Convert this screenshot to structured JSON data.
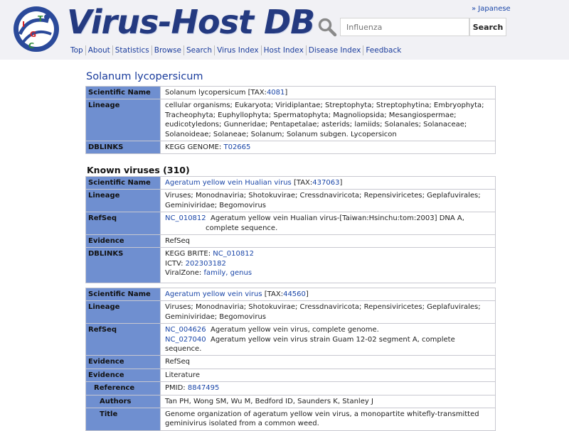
{
  "header": {
    "site_title": "Virus-Host DB",
    "lang_link": "» Japanese",
    "search_placeholder": "Influenza",
    "search_button": "Search"
  },
  "nav": [
    "Top",
    "About",
    "Statistics",
    "Browse",
    "Search",
    "Virus Index",
    "Host Index",
    "Disease Index",
    "Feedback"
  ],
  "host": {
    "title": "Solanum lycopersicum",
    "sci_label": "Scientific Name",
    "sci_value": "Solanum lycopersicum [TAX:",
    "tax_id": "4081",
    "tax_close": "]",
    "lineage_label": "Lineage",
    "lineage": "cellular organisms; Eukaryota; Viridiplantae; Streptophyta; Streptophytina; Embryophyta; Tracheophyta; Euphyllophyta; Spermatophyta; Magnoliopsida; Mesangiospermae; eudicotyledons; Gunneridae; Pentapetalae; asterids; lamiids; Solanales; Solanaceae; Solanoideae; Solaneae; Solanum; Solanum subgen. Lycopersicon",
    "dblinks_label": "DBLINKS",
    "dblinks_prefix": "KEGG GENOME: ",
    "dblinks_id": "T02665"
  },
  "known_viruses_title": "Known viruses (310)",
  "virus1": {
    "sci_label": "Scientific Name",
    "name": "Ageratum yellow vein Hualian virus",
    "tax_open": " [TAX:",
    "tax_id": "437063",
    "tax_close": "]",
    "lineage_label": "Lineage",
    "lineage": "Viruses; Monodnaviria; Shotokuvirae; Cressdnaviricota; Repensiviricetes; Geplafuvirales; Geminiviridae; Begomovirus",
    "refseq_label": "RefSeq",
    "refseq_id": "NC_010812",
    "refseq_desc_1": "Ageratum yellow vein Hualian virus-[Taiwan:Hsinchu:tom:2003] DNA A,",
    "refseq_desc_2": "complete sequence.",
    "evidence_label": "Evidence",
    "evidence": "RefSeq",
    "dblinks_label": "DBLINKS",
    "kegg_label": "KEGG BRITE: ",
    "kegg_id": "NC_010812",
    "ictv_label": "ICTV: ",
    "ictv_id": "202303182",
    "viralzone_label": "ViralZone: ",
    "viralzone_links": "family, genus"
  },
  "virus2": {
    "sci_label": "Scientific Name",
    "name": "Ageratum yellow vein virus",
    "tax_open": " [TAX:",
    "tax_id": "44560",
    "tax_close": "]",
    "lineage_label": "Lineage",
    "lineage": "Viruses; Monodnaviria; Shotokuvirae; Cressdnaviricota; Repensiviricetes; Geplafuvirales; Geminiviridae; Begomovirus",
    "refseq_label": "RefSeq",
    "refseq1_id": "NC_004626",
    "refseq1_desc": "Ageratum yellow vein virus, complete genome.",
    "refseq2_id": "NC_027040",
    "refseq2_desc": "Ageratum yellow vein virus strain Guam 12-02 segment A, complete sequence.",
    "evidence1_label": "Evidence",
    "evidence1": "RefSeq",
    "evidence2_label": "Evidence",
    "evidence2": "Literature",
    "reference_label": "Reference",
    "pmid_label": "PMID: ",
    "pmid": "8847495",
    "authors_label": "Authors",
    "authors": "Tan PH, Wong SM, Wu M, Bedford ID, Saunders K, Stanley J",
    "title_label": "Title",
    "title": "Genome organization of ageratum yellow vein virus, a monopartite whitefly-transmitted geminivirus isolated from a common weed."
  }
}
